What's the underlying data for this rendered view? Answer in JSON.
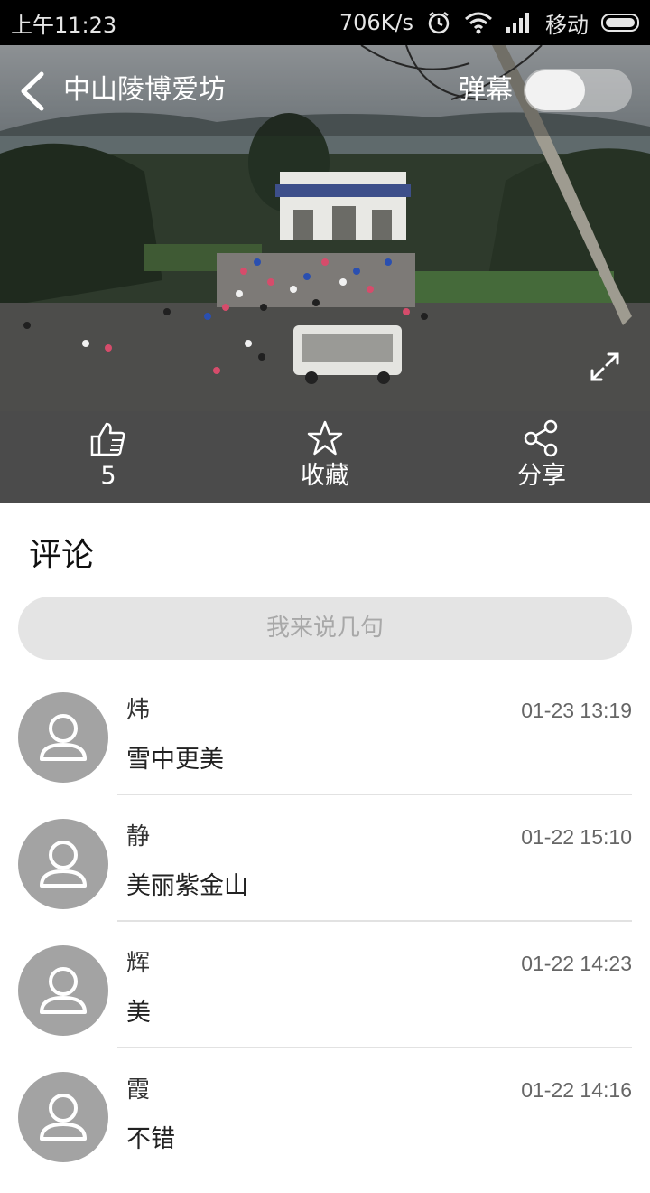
{
  "status_bar": {
    "time": "上午11:23",
    "speed": "706K/s",
    "carrier": "移动",
    "icons": [
      "alarm-icon",
      "wifi-icon",
      "signal-icon",
      "battery-icon"
    ]
  },
  "header": {
    "title": "中山陵博爱坊",
    "danmu_label": "弹幕",
    "danmu_enabled": false
  },
  "actions": {
    "like_count": "5",
    "favorite_label": "收藏",
    "share_label": "分享"
  },
  "comments": {
    "heading": "评论",
    "input_placeholder": "我来说几句",
    "items": [
      {
        "name": "炜",
        "time": "01-23 13:19",
        "text": "雪中更美"
      },
      {
        "name": "静",
        "time": "01-22 15:10",
        "text": "美丽紫金山"
      },
      {
        "name": "辉",
        "time": "01-22 14:23",
        "text": "美"
      },
      {
        "name": "霞",
        "time": "01-22 14:16",
        "text": "不错"
      }
    ]
  },
  "colors": {
    "action_bar": "#4b4b4b",
    "input_bg": "#e4e4e4",
    "avatar_bg": "#a3a3a3"
  }
}
